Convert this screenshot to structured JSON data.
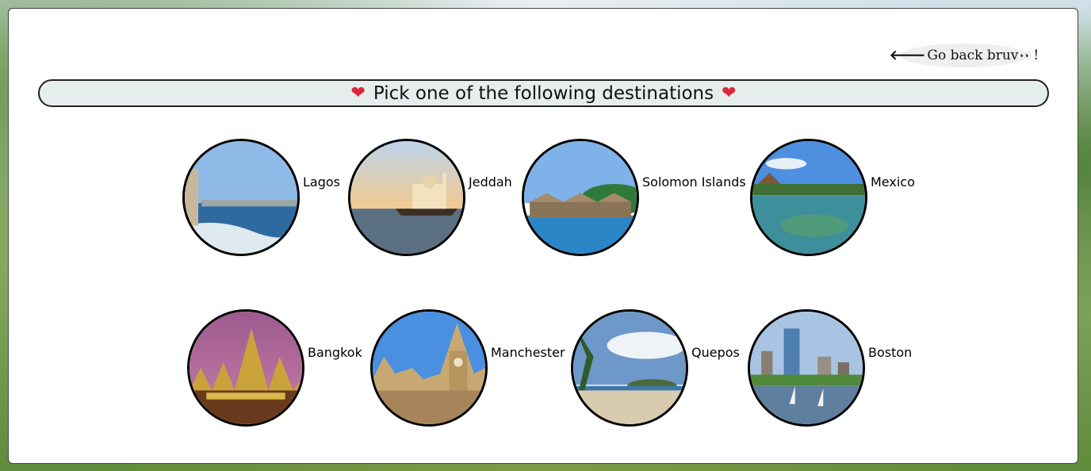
{
  "back_link": {
    "label": "Go back bruv",
    "eyes": "👀",
    "suffix": "!"
  },
  "header": {
    "title": "Pick one of the following destinations",
    "heart": "❤"
  },
  "destinations": [
    {
      "name": "Lagos"
    },
    {
      "name": "Jeddah"
    },
    {
      "name": "Solomon Islands"
    },
    {
      "name": "Mexico"
    },
    {
      "name": "Bangkok"
    },
    {
      "name": "Manchester"
    },
    {
      "name": "Quepos"
    },
    {
      "name": "Boston"
    }
  ]
}
